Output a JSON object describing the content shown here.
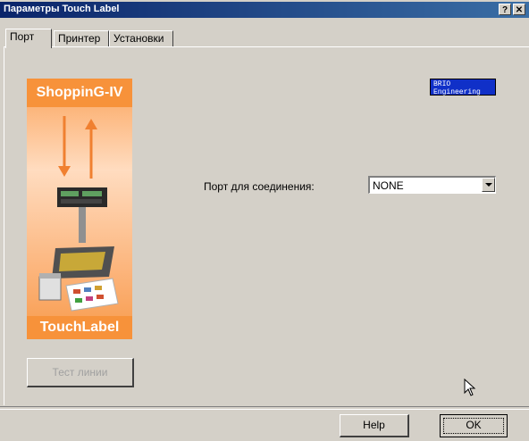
{
  "window": {
    "title": "Параметры Touch Label",
    "help_glyph": "?",
    "close_glyph": "✕"
  },
  "tabs": [
    {
      "label": "Порт",
      "active": true
    },
    {
      "label": "Принтер",
      "active": false
    },
    {
      "label": "Установки",
      "active": false
    }
  ],
  "illustration": {
    "top_text": "ShoppinG-IV",
    "bottom_text": "TouchLabel"
  },
  "logo": {
    "line1": "BRIO",
    "line2": "Engineering"
  },
  "port": {
    "label": "Порт для соединения:",
    "selected": "NONE"
  },
  "buttons": {
    "test_line": "Тест линии",
    "help": "Help",
    "ok": "OK"
  },
  "colors": {
    "titlebar": "#0a246a",
    "face": "#d4d0c8",
    "art_orange": "#f7923a",
    "logo_blue": "#1030c8"
  }
}
